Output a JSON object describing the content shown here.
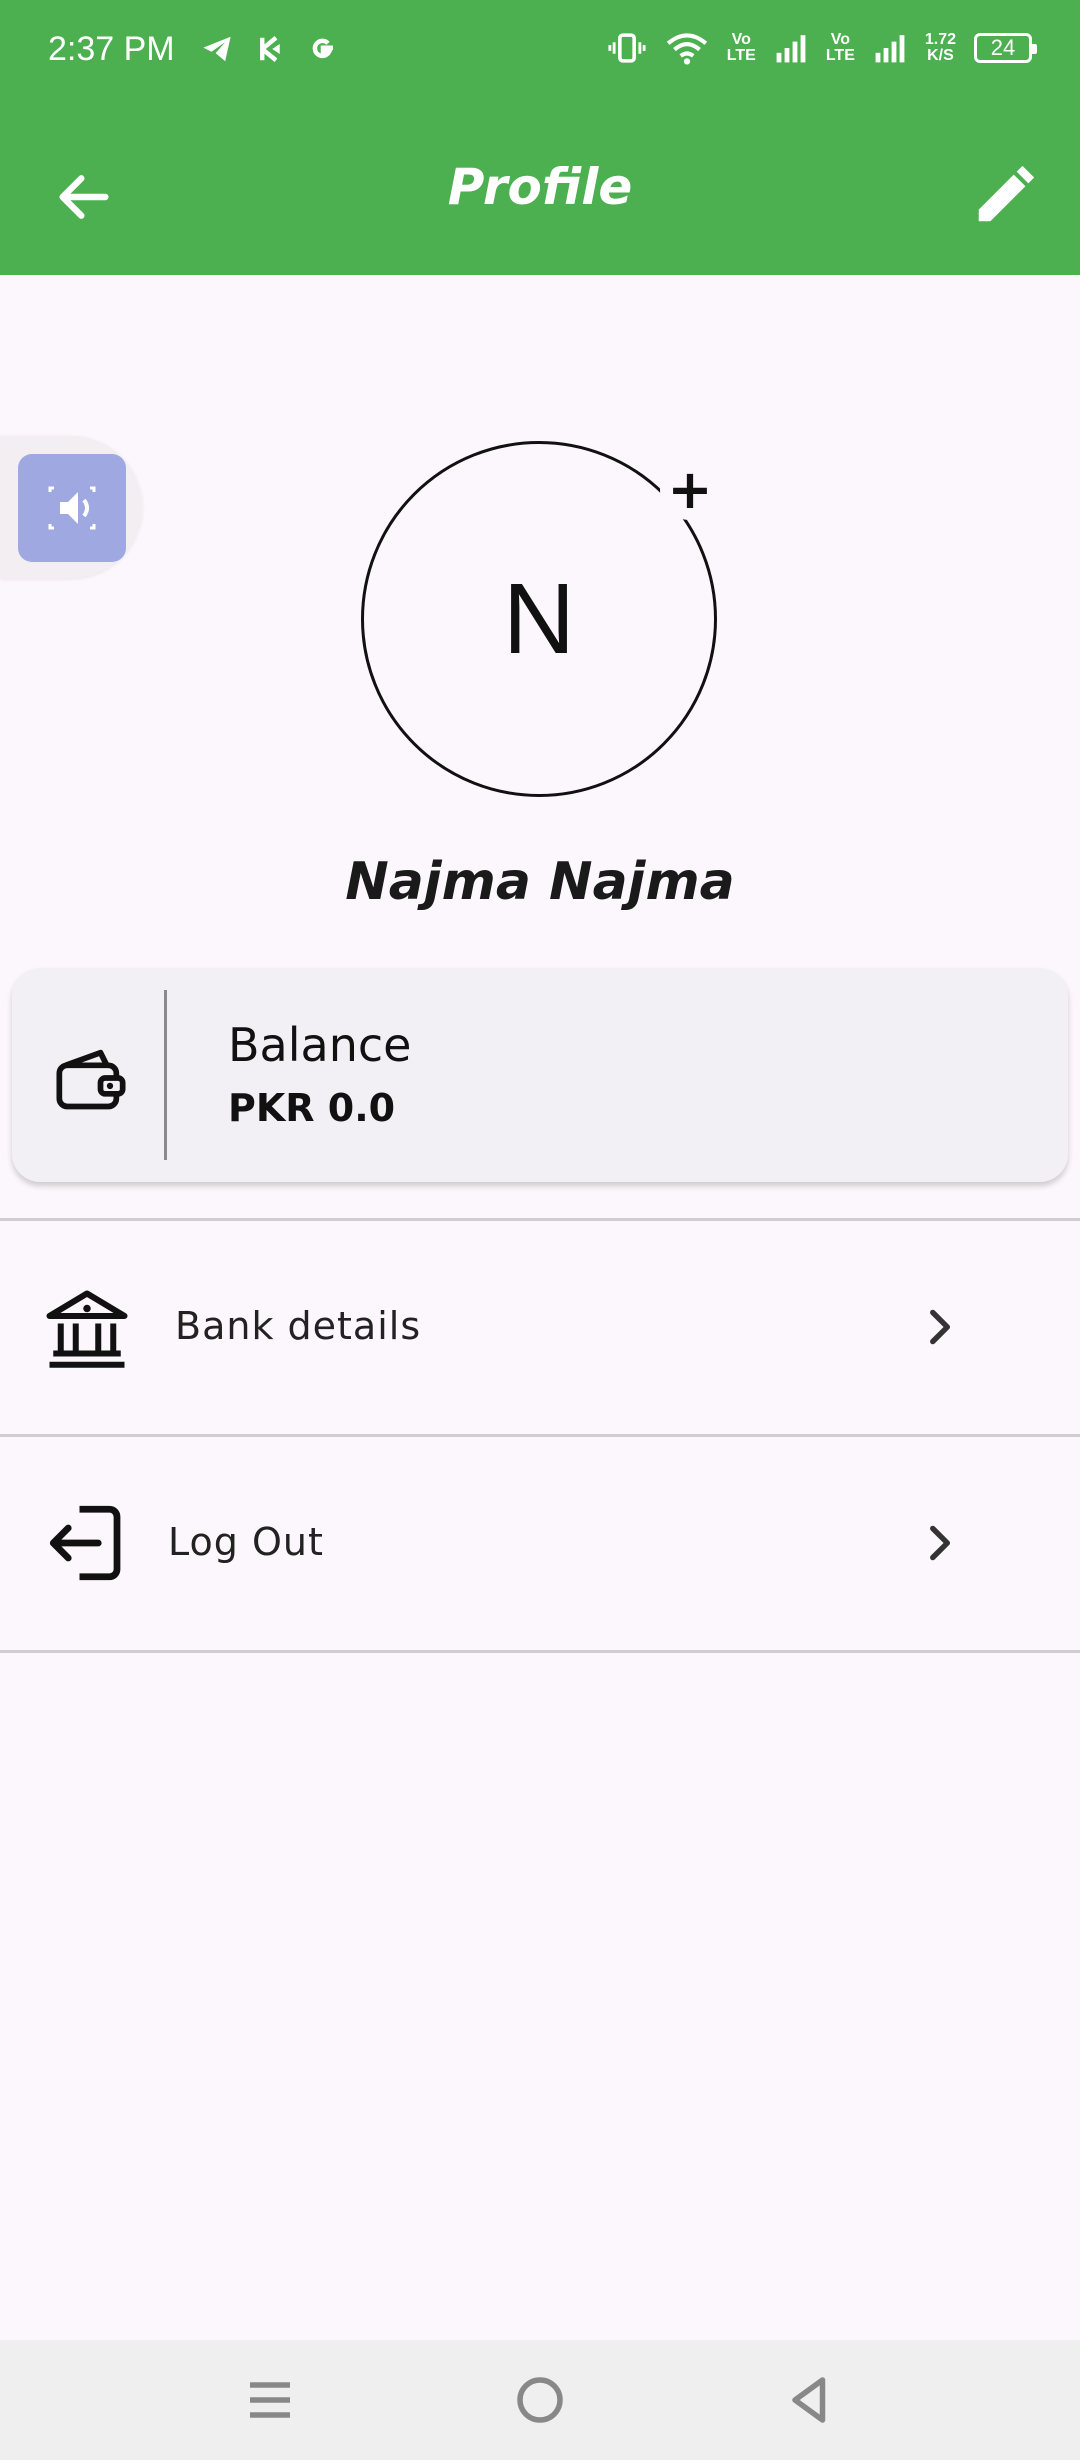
{
  "status_bar": {
    "time": "2:37 PM",
    "network_speed_top": "1.72",
    "network_speed_bottom": "K/S",
    "volte1_top": "Vo",
    "volte1_bottom": "LTE",
    "volte2_top": "Vo",
    "volte2_bottom": "LTE",
    "battery": "24",
    "icons": [
      "telegram-icon",
      "kb-icon",
      "google-icon",
      "vibrate-icon",
      "wifi-icon",
      "signal-icon",
      "signal-icon",
      "battery-icon"
    ]
  },
  "app_bar": {
    "title": "Profile",
    "back_icon": "arrow-left-icon",
    "edit_icon": "pencil-icon"
  },
  "floating_button": {
    "icon": "speaker-icon"
  },
  "profile": {
    "avatar_initial": "N",
    "add_icon": "+",
    "name": "Najma Najma"
  },
  "balance": {
    "label": "Balance",
    "value": "PKR 0.0",
    "icon": "wallet-icon"
  },
  "menu": [
    {
      "label": "Bank details",
      "icon": "bank-icon"
    },
    {
      "label": "Log Out",
      "icon": "logout-icon"
    }
  ],
  "colors": {
    "primary": "#4caf50",
    "background": "#fcf7fc",
    "card": "#f2eff5",
    "float_button": "#9fa8e0"
  },
  "nav_bar": {
    "icons": [
      "menu-icon",
      "home-icon",
      "back-icon"
    ]
  }
}
